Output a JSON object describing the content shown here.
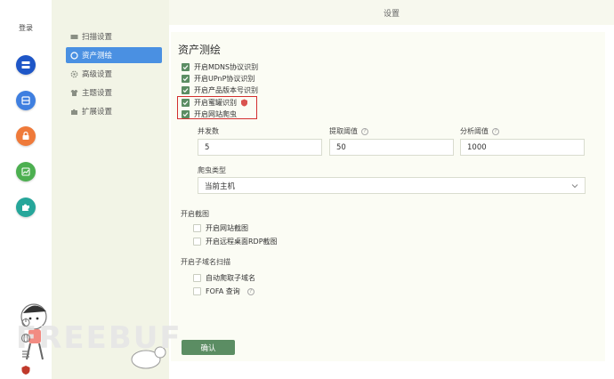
{
  "window": {
    "title": "设置"
  },
  "rail": {
    "login_label": "登录",
    "buttons": [
      {
        "name": "rail-app-1",
        "icon": "server-icon",
        "color": "#1e56c7"
      },
      {
        "name": "rail-app-2",
        "icon": "database-icon",
        "color": "#3f7fe0"
      },
      {
        "name": "rail-app-3",
        "icon": "lock-icon",
        "color": "#ef7a3a"
      },
      {
        "name": "rail-app-4",
        "icon": "chart-icon",
        "color": "#4caf50"
      },
      {
        "name": "rail-app-5",
        "icon": "puzzle-icon",
        "color": "#26a69a"
      }
    ]
  },
  "sidebar": {
    "items": [
      {
        "label": "扫描设置",
        "icon": "scan-icon",
        "active": false
      },
      {
        "label": "资产测绘",
        "icon": "map-icon",
        "active": true
      },
      {
        "label": "高级设置",
        "icon": "gear-icon",
        "active": false
      },
      {
        "label": "主题设置",
        "icon": "shirt-icon",
        "active": false
      },
      {
        "label": "扩展设置",
        "icon": "puzzle-icon",
        "active": false
      }
    ]
  },
  "main": {
    "section_title": "资产测绘",
    "options": [
      {
        "label": "开启MDNS协议识别",
        "checked": true
      },
      {
        "label": "开启UPnP协议识别",
        "checked": true
      },
      {
        "label": "开启产品版本号识别",
        "checked": true
      },
      {
        "label": "开启蜜罐识别",
        "checked": true,
        "badge": "honeypot-icon"
      },
      {
        "label": "开启网站爬虫",
        "checked": true
      }
    ],
    "fields": {
      "concurrency": {
        "label": "并发数",
        "value": "5"
      },
      "extract_threshold": {
        "label": "提取阈值",
        "value": "50"
      },
      "analyze_threshold": {
        "label": "分析阈值",
        "value": "1000"
      }
    },
    "crawler_type": {
      "label": "爬虫类型",
      "selected": "当前主机"
    },
    "screenshot": {
      "title": "开启截图",
      "options": [
        {
          "label": "开启网站截图",
          "checked": false
        },
        {
          "label": "开启远程桌面RDP截图",
          "checked": false
        }
      ]
    },
    "subdomain": {
      "title": "开启子域名扫描",
      "options": [
        {
          "label": "自动爬取子域名",
          "checked": false
        },
        {
          "label": "FOFA 查询",
          "checked": false,
          "help": true
        }
      ]
    },
    "confirm_label": "确认"
  },
  "watermark": "FREEBUF",
  "colors": {
    "accent": "#5b8d63",
    "active_tab": "#4a90e2",
    "highlight": "#d32f2f"
  }
}
